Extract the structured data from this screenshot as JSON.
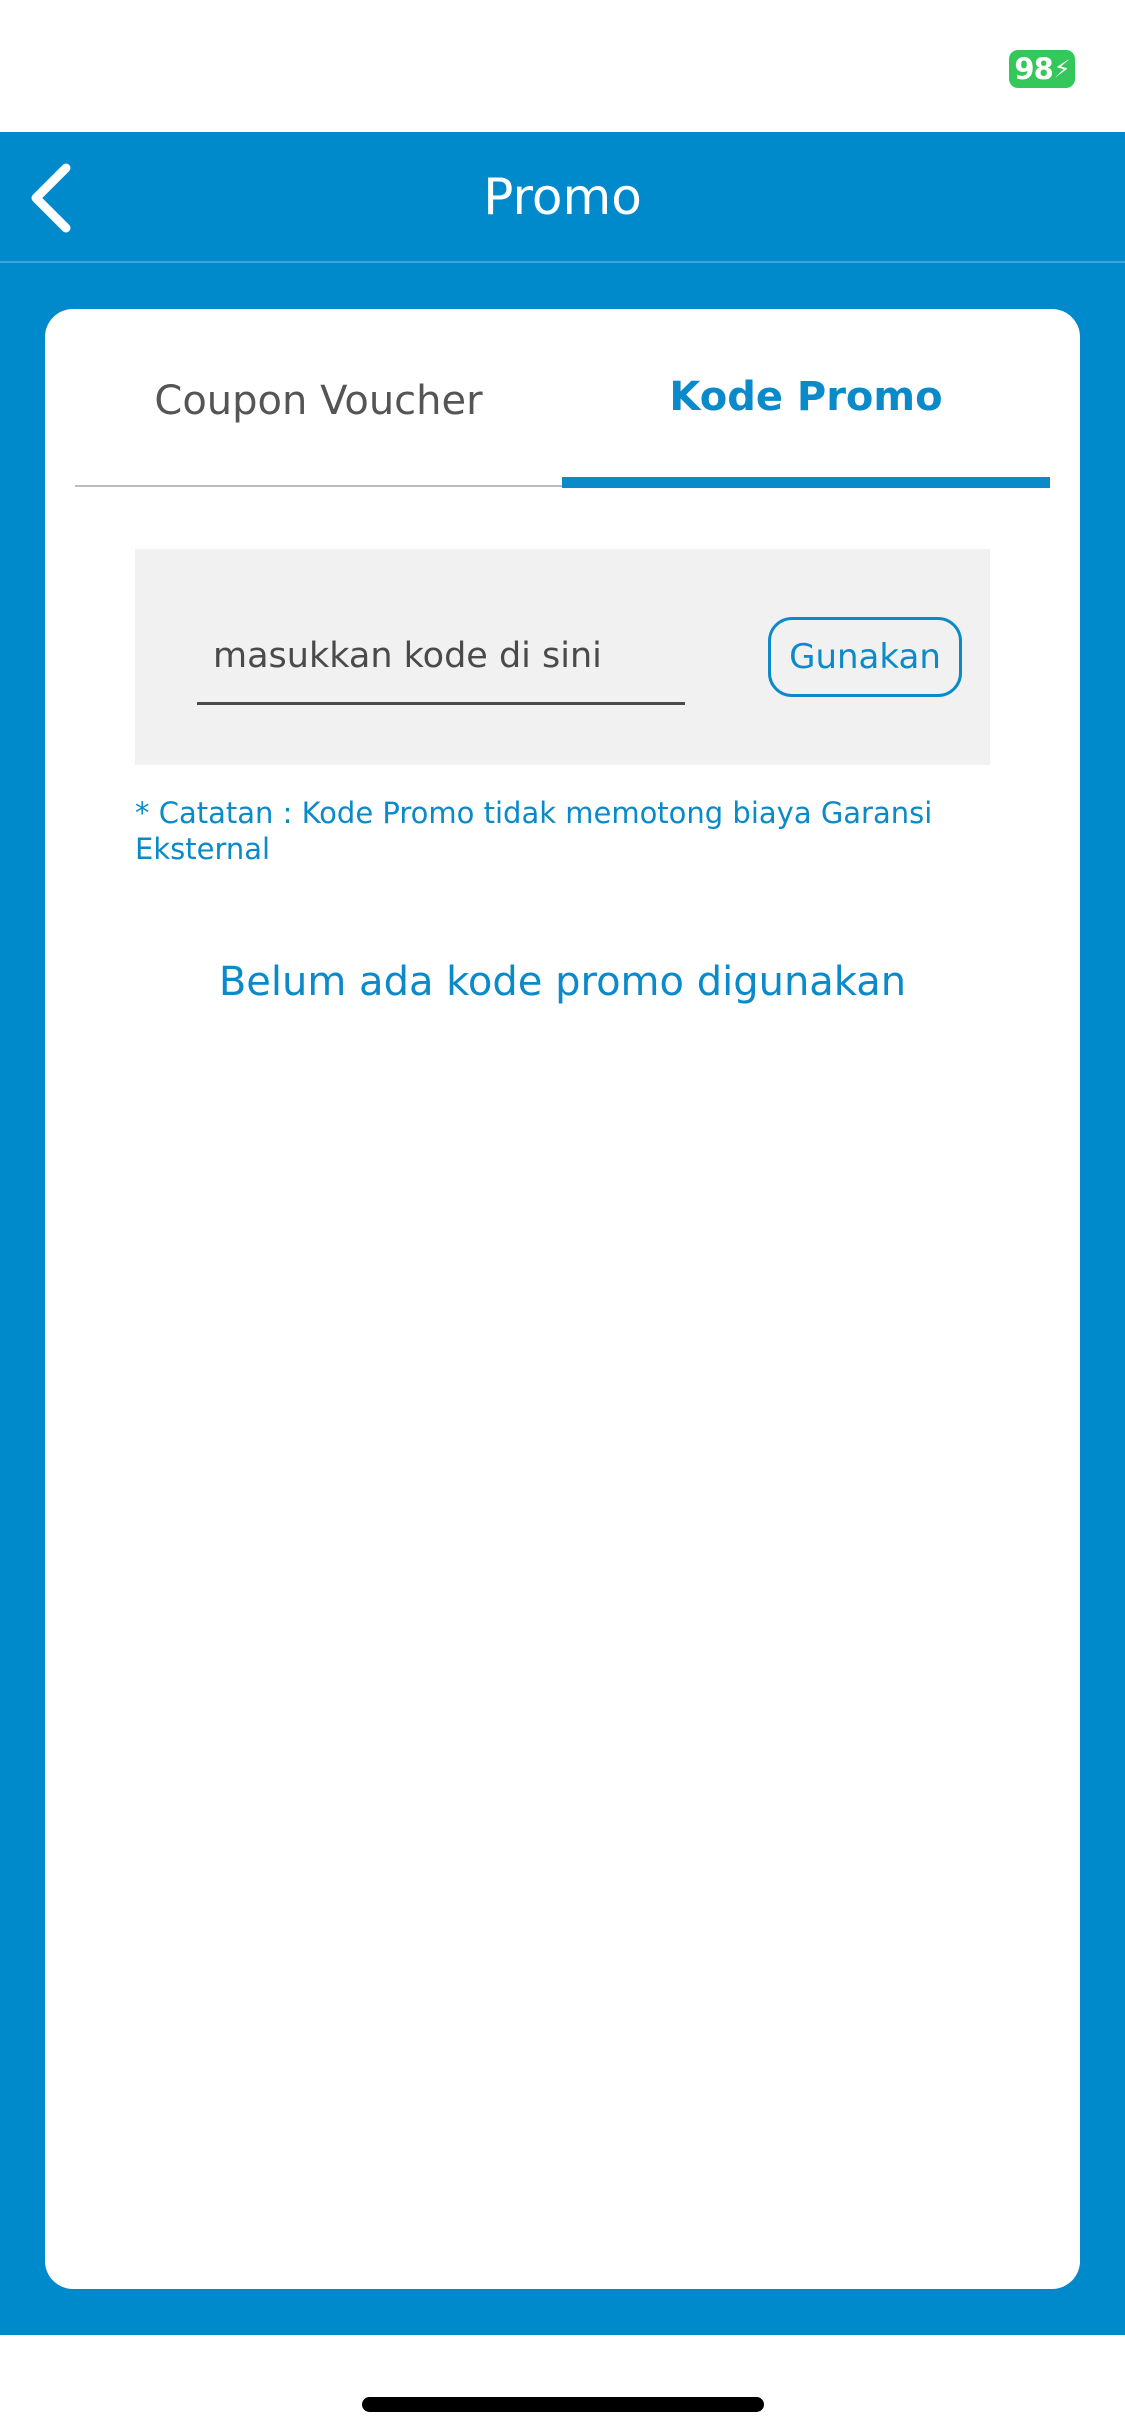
{
  "status_bar": {
    "battery_level": "98",
    "battery_color": "#34c759"
  },
  "header": {
    "title": "Promo",
    "back_icon": "chevron-left-icon",
    "background_color": "#008acc"
  },
  "tabs": [
    {
      "label": "Coupon Voucher",
      "active": false
    },
    {
      "label": "Kode Promo",
      "active": true
    }
  ],
  "promo_form": {
    "input_value": "",
    "input_placeholder": "masukkan kode di sini",
    "apply_label": "Gunakan"
  },
  "note": "* Catatan : Kode Promo tidak memotong biaya Garansi Eksternal",
  "empty_state": "Belum ada kode promo digunakan",
  "accent_color": "#0a8ac9"
}
